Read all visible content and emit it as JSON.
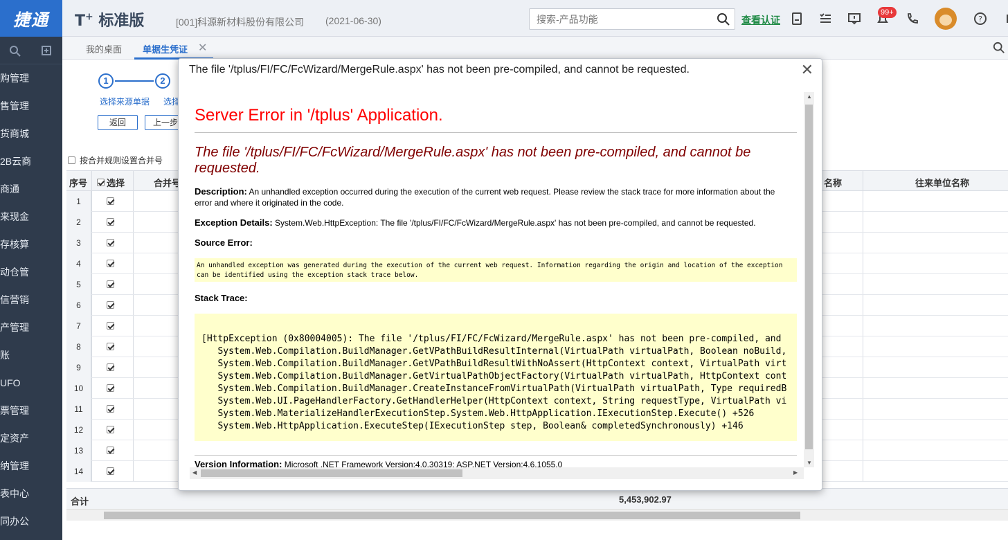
{
  "header": {
    "logo": "捷通",
    "brand": "T",
    "brand_plus": "+",
    "brand_suffix": "标准版",
    "company": "[001]科源新材料股份有限公司",
    "date": "(2021-06-30)",
    "search_placeholder": "搜索-产品功能",
    "verify": "查看认证",
    "badge": "99+"
  },
  "tabs": {
    "desktop": "我的桌面",
    "active": "单据生凭证",
    "close": "✕"
  },
  "sidebar": {
    "items": [
      "购管理",
      "售管理",
      "货商城",
      "2B云商",
      "商通",
      "来现金",
      "存核算",
      "动仓管",
      "信营销",
      "产管理",
      "账",
      "UFO",
      "票管理",
      "定资产",
      "纳管理",
      "表中心",
      "同办公"
    ]
  },
  "wizard": {
    "step1_num": "1",
    "step2_num": "2",
    "step1_label": "选择来源单据",
    "step2_label": "选择",
    "back_button": "返回",
    "prev_button": "上一步",
    "merge_checkbox": "按合并规则设置合并号"
  },
  "grid": {
    "headers": {
      "seq": "序号",
      "select": "选择",
      "merge": "合并号",
      "name_partial": "名称",
      "partner": "往来单位名称"
    },
    "rows": [
      "1",
      "2",
      "3",
      "4",
      "5",
      "6",
      "7",
      "8",
      "9",
      "10",
      "11",
      "12",
      "13",
      "14"
    ],
    "total_label": "合计",
    "total_value": "5,453,902.97"
  },
  "modal": {
    "title": "The file '/tplus/FI/FC/FcWizard/MergeRule.aspx' has not been pre-compiled, and cannot be requested.",
    "close": "✕",
    "error_heading": "Server Error in '/tplus' Application.",
    "error_subheading": "The file '/tplus/FI/FC/FcWizard/MergeRule.aspx' has not been pre-compiled, and cannot be requested.",
    "description_label": "Description:",
    "description_text": "An unhandled exception occurred during the execution of the current web request. Please review the stack trace for more information about the error and where it originated in the code.",
    "exception_label": "Exception Details:",
    "exception_text": "System.Web.HttpException: The file '/tplus/FI/FC/FcWizard/MergeRule.aspx' has not been pre-compiled, and cannot be requested.",
    "source_label": "Source Error:",
    "source_text": "An unhandled exception was generated during the execution of the current web request. Information regarding the origin and location of the exception can be identified using the exception stack trace below.",
    "stack_label": "Stack Trace:",
    "stack_lines": [
      "[HttpException (0x80004005): The file '/tplus/FI/FC/FcWizard/MergeRule.aspx' has not been pre-compiled, and",
      "   System.Web.Compilation.BuildManager.GetVPathBuildResultInternal(VirtualPath virtualPath, Boolean noBuild,",
      "   System.Web.Compilation.BuildManager.GetVPathBuildResultWithNoAssert(HttpContext context, VirtualPath virt",
      "   System.Web.Compilation.BuildManager.GetVirtualPathObjectFactory(VirtualPath virtualPath, HttpContext cont",
      "   System.Web.Compilation.BuildManager.CreateInstanceFromVirtualPath(VirtualPath virtualPath, Type requiredB",
      "   System.Web.UI.PageHandlerFactory.GetHandlerHelper(HttpContext context, String requestType, VirtualPath vi",
      "   System.Web.MaterializeHandlerExecutionStep.System.Web.HttpApplication.IExecutionStep.Execute() +526",
      "   System.Web.HttpApplication.ExecuteStep(IExecutionStep step, Boolean& completedSynchronously) +146"
    ],
    "version_label": "Version Information:",
    "version_text": "Microsoft .NET Framework Version:4.0.30319; ASP.NET Version:4.6.1055.0"
  },
  "colors": {
    "accent": "#2b6fcc",
    "sidebar": "#2f3b4c",
    "error_red": "#ff0000",
    "error_maroon": "#800000",
    "yellow_box": "#ffffcc",
    "verify_green": "#1f8a45"
  }
}
